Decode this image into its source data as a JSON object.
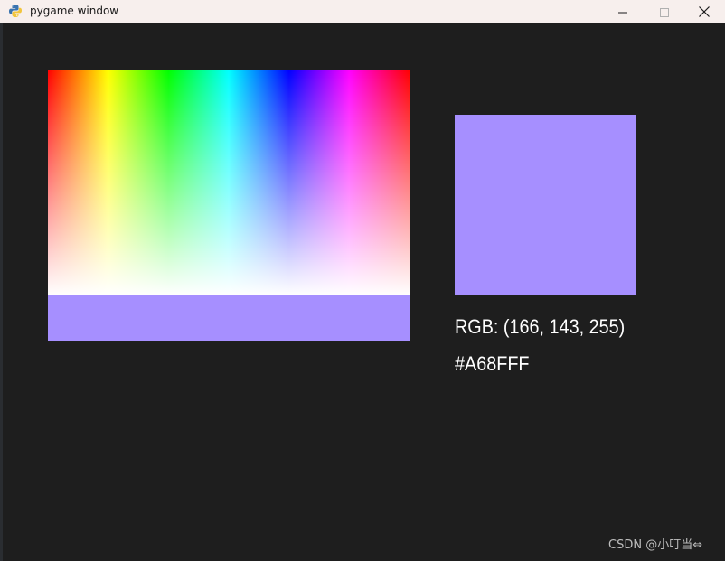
{
  "window": {
    "title": "pygame window",
    "app_icon": "pygame-snake-icon",
    "controls": {
      "minimize_icon": "minimize-icon",
      "maximize_icon": "maximize-icon",
      "close_icon": "close-icon"
    }
  },
  "colors": {
    "background": "#1e1e1e",
    "titlebar": "#f7efed",
    "selected": "#A68FFF",
    "text": "#ffffff"
  },
  "picker": {
    "selected_rgb": [
      166,
      143,
      255
    ],
    "rgb_text": "RGB: (166, 143, 255)",
    "hex_text": "#A68FFF"
  },
  "watermark": "CSDN @小叮当⇔"
}
